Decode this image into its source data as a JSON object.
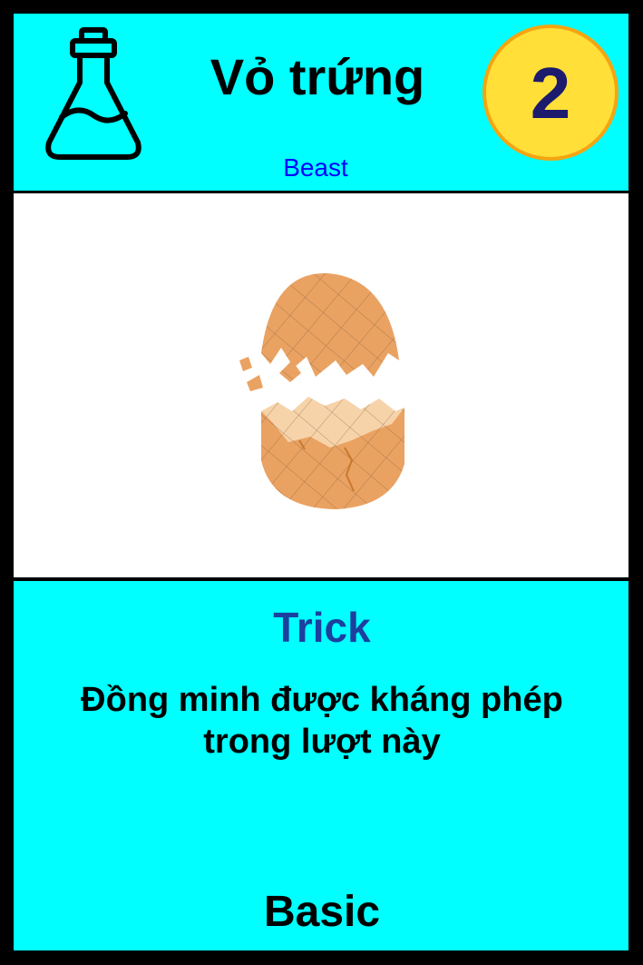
{
  "card": {
    "name": "Vỏ trứng",
    "subtype": "Beast",
    "cost": "2",
    "type_icon": "flask-icon",
    "art": "cracked-egg-illustration",
    "card_type": "Trick",
    "effect": "Đồng minh được kháng phép trong lượt này",
    "rarity": "Basic"
  },
  "colors": {
    "panel": "#00ffff",
    "border": "#000000",
    "cost_fill": "#ffdf38",
    "cost_ring": "#f4a511",
    "cost_text": "#1c1b6e",
    "subtype_text": "#0000ff",
    "card_type_text": "#1d3f9e"
  }
}
